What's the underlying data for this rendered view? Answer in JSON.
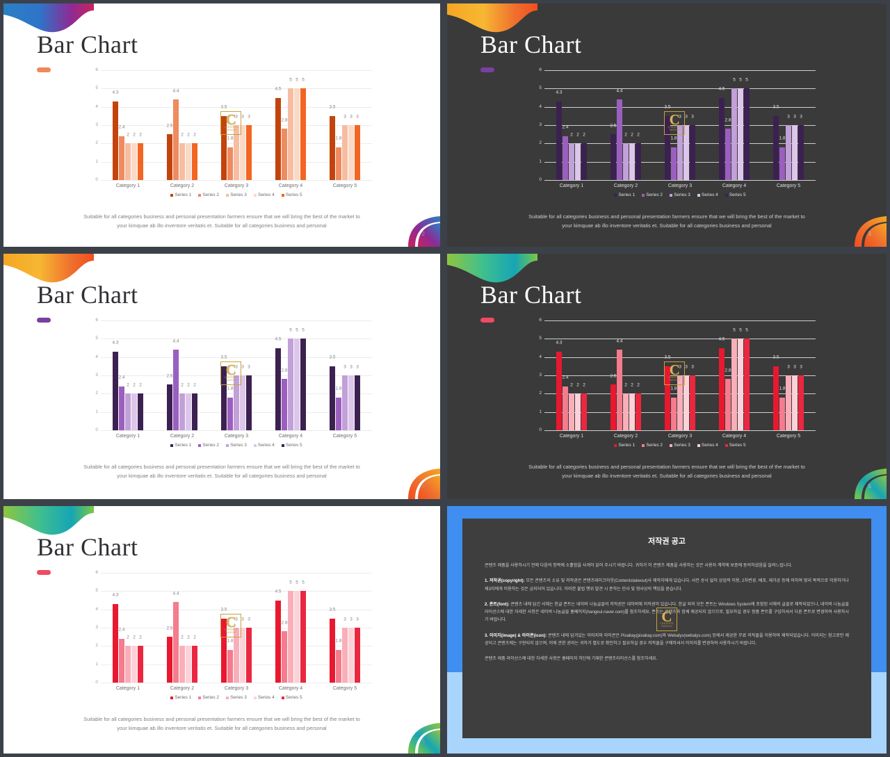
{
  "deck": {
    "slide_title": "Bar Chart",
    "caption": "Suitable for all categories business and personal presentation farmers ensure that we will bring the best of the market to your kimquae ab illo inventore veritatis et. Suitable for all categories business and personal",
    "watermark": {
      "letter": "C",
      "line1": "CONTENTS",
      "line2": "TAKEOUT"
    }
  },
  "slides": [
    {
      "page": "2",
      "theme": "light",
      "palette": "orange",
      "swirl_tl": "blue-magenta",
      "swirl_br": "blue-magenta"
    },
    {
      "page": "3",
      "theme": "dark",
      "palette": "purple",
      "swirl_tl": "orange-yellow",
      "swirl_br": "orange-yellow"
    },
    {
      "page": "4",
      "theme": "light",
      "palette": "purple",
      "swirl_tl": "orange-yellow",
      "swirl_br": "orange-yellow"
    },
    {
      "page": "5",
      "theme": "dark",
      "palette": "red",
      "swirl_tl": "green-teal",
      "swirl_br": "green-teal"
    },
    {
      "page": "6",
      "theme": "light",
      "palette": "red",
      "swirl_tl": "green-teal",
      "swirl_br": "green-teal"
    }
  ],
  "palettes": {
    "orange": [
      "#C3430D",
      "#EE8B5F",
      "#F6BDA1",
      "#FAD9C7",
      "#F26522"
    ],
    "purple": [
      "#3B2150",
      "#9B5FC0",
      "#C2A0D8",
      "#DCC6E9",
      "#3B2150"
    ],
    "red": [
      "#E8182F",
      "#F47C8D",
      "#F9AFB9",
      "#FCD2D8",
      "#EB2740"
    ]
  },
  "accent_dash": {
    "orange": "#F2875A",
    "purple": "#7B3FA0",
    "red": "#F04A63"
  },
  "chart_data": {
    "type": "bar",
    "title": "Bar Chart",
    "xlabel": "",
    "ylabel": "",
    "ylim": [
      0,
      6
    ],
    "yticks": [
      0,
      1,
      2,
      3,
      4,
      5,
      6
    ],
    "grid": true,
    "legend_position": "bottom",
    "categories": [
      "Category 1",
      "Category 2",
      "Category 3",
      "Category 4",
      "Category 5"
    ],
    "series": [
      {
        "name": "Series 1",
        "values": [
          4.3,
          2.5,
          3.5,
          4.5,
          3.5
        ]
      },
      {
        "name": "Series 2",
        "values": [
          2.4,
          4.4,
          1.8,
          2.8,
          1.8
        ]
      },
      {
        "name": "Series 3",
        "values": [
          2,
          2,
          3,
          5,
          3
        ]
      },
      {
        "name": "Series 4",
        "values": [
          2,
          2,
          3,
          5,
          3
        ]
      },
      {
        "name": "Series 5",
        "values": [
          2,
          2,
          3,
          5,
          3
        ]
      }
    ],
    "data_labels": [
      [
        "4.3",
        "2.4",
        "2",
        "2",
        "2"
      ],
      [
        "2.5",
        "4.4",
        "2",
        "2",
        "2"
      ],
      [
        "3.5",
        "1.8",
        "3",
        "3",
        "3"
      ],
      [
        "4.5",
        "2.8",
        "5",
        "5",
        "5"
      ],
      [
        "3.5",
        "1.8",
        "3",
        "3",
        "3"
      ]
    ]
  },
  "copyright": {
    "title": "저작권 공고",
    "intro": "콘텐츠 제품을 사용하시기 전에 다음의 항목에 소홀함을 사게이 읽어 주시기 바랍니다. 귀하가 이 콘텐츠 제품을 사용하는 것은 사용자 계약에 보증에 동의하셨음을 알려느립니다.",
    "sections": [
      {
        "heading": "1. 저작권(copyright):",
        "body": " 모든 콘텐츠의 소유 및 저작권은 콘텐츠테이크아웃(Contentstakeout)사 제작자에게 있습니다. 사전 승낙 없이 상업적 이용, 2차변경, 배포, 재가공 등에 의하여 영리 목적으로 이용하거나 제3자에게 이용하는 것은 금지되어 있습니다. 이러한 불법 행위 발견 시 준하는 민사 및 형사상의 책임을 묻습니다."
      },
      {
        "heading": "2. 폰트(font):",
        "body": " 콘텐츠 내에 담긴 서체는 한글 폰트는 네이버 나눔글꼴의 저작권은 네이버에 저작권이 있습니다. 한글 외의 모든 폰트는 Windows System에 포함된 서체의 글꼴로 제작되었으나, 네이버 나눔글꼴 라이선스에 대한 자세한 사항은 네이버 나눔글꼴 홈페이지(hangeul.naver.com)를 참조하세요. 폰트는 콘텐츠와 함께 제공되지 않으므로, 필요하실 경우 정품 폰트를 구입하셔서 다른 폰트로 변경하여 사용하시기 바랍니다."
      },
      {
        "heading": "3. 이미지(image) & 아이콘(icon):",
        "body": " 콘텐츠 내에 담겨있는 이미지와 아이콘은 Pixabay(pixabay.com)와 Webalys(webalys.com) 등에서 제공한 무료 저작물을 이용하여 제작되었습니다. 이미지는 참고로만 제공되고 콘텐츠에는 구현되지 않으며, 이에 관한 권리는 귀하가 별도로 확인하고 필요하실 경우 저작물을 구매하셔서 이미지를 변경하여 사용하시기 바랍니다."
      }
    ],
    "footer": "콘텐츠 제품 라이선스에 대한 자세한 사항은 홈페이지 하단에 기재한 콘텐츠라이선스를 참조하세요."
  }
}
